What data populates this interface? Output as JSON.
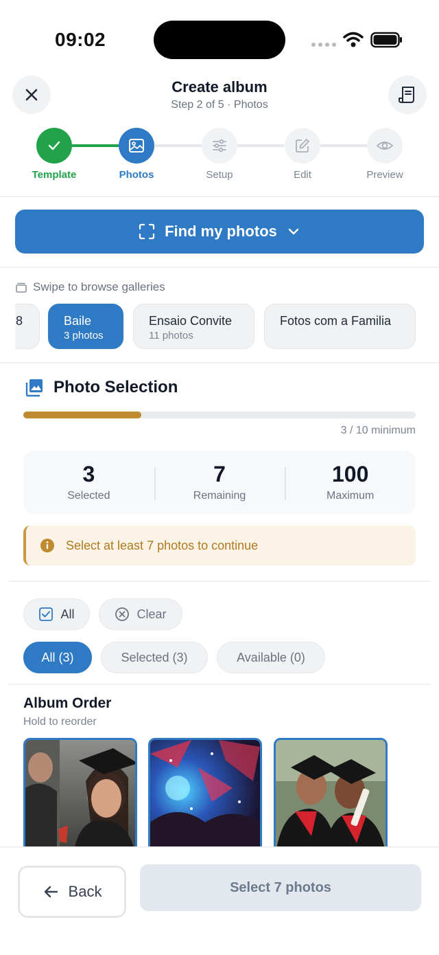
{
  "status_bar": {
    "time": "09:02"
  },
  "header": {
    "title": "Create album",
    "subtitle": "Step 2 of 5 · Photos"
  },
  "stepper": {
    "steps": [
      {
        "label": "Template",
        "state": "done",
        "icon": "check-icon"
      },
      {
        "label": "Photos",
        "state": "active",
        "icon": "image-icon"
      },
      {
        "label": "Setup",
        "state": "pending",
        "icon": "sliders-icon"
      },
      {
        "label": "Edit",
        "state": "pending",
        "icon": "edit-icon"
      },
      {
        "label": "Preview",
        "state": "pending",
        "icon": "eye-icon"
      }
    ]
  },
  "find_button": {
    "label": "Find my photos"
  },
  "galleries": {
    "hint": "Swipe to browse galleries",
    "items": [
      {
        "name": "8",
        "count": ""
      },
      {
        "name": "Baile",
        "count": "3 photos",
        "active": true
      },
      {
        "name": "Ensaio Convite",
        "count": "11 photos"
      },
      {
        "name": "Fotos com a Familia",
        "count": ""
      }
    ]
  },
  "selection": {
    "title": "Photo Selection",
    "progress_fraction": 0.3,
    "progress_text": "3 / 10 minimum",
    "stats": [
      {
        "value": "3",
        "label": "Selected"
      },
      {
        "value": "7",
        "label": "Remaining"
      },
      {
        "value": "100",
        "label": "Maximum"
      }
    ],
    "warning": "Select at least 7 photos to continue"
  },
  "actions": {
    "all": "All",
    "clear": "Clear"
  },
  "filters": [
    {
      "label": "All (3)",
      "active": true
    },
    {
      "label": "Selected (3)",
      "active": false
    },
    {
      "label": "Available (0)",
      "active": false
    }
  ],
  "album_order": {
    "title": "Album Order",
    "subtitle": "Hold to reorder"
  },
  "footer": {
    "back": "Back",
    "next": "Select 7 photos"
  },
  "colors": {
    "primary": "#2f7ac4",
    "success": "#22a34a",
    "warning": "#c08a30"
  }
}
